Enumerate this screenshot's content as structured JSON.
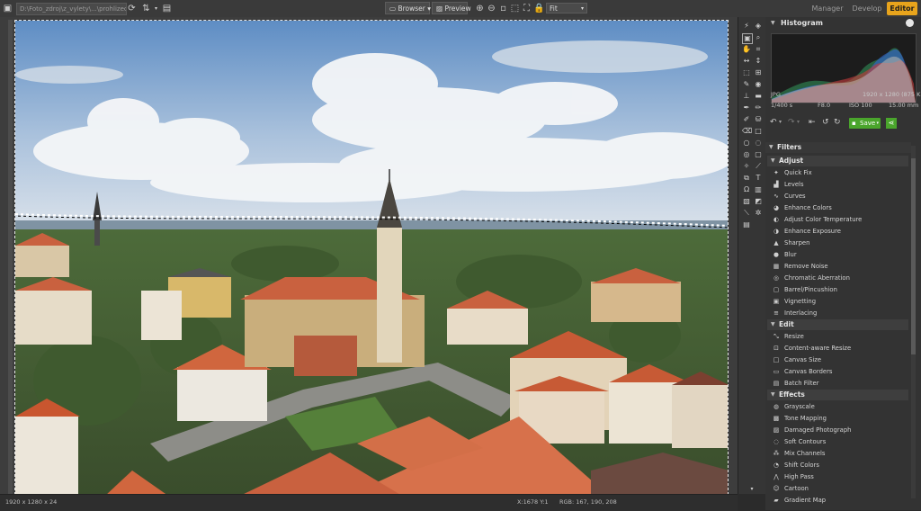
{
  "toolbar": {
    "path": "D:\\Foto_zdroj\\z_vylety\\...\\prohlizec",
    "browser_label": "Browser",
    "preview_label": "Preview",
    "zoom_value": "Fit",
    "modes": [
      "Manager",
      "Develop",
      "Editor"
    ],
    "active_mode": "Editor"
  },
  "colors": {
    "accent": "#e8a41c",
    "save_green": "#4aa52c"
  },
  "histogram": {
    "title": "Histogram",
    "format": "JPG",
    "dimensions": "1920 x 1280 (875 KB)",
    "shutter": "1/400 s",
    "aperture": "F8.0",
    "iso": "ISO 100",
    "focal": "15.00 mm"
  },
  "actions": {
    "save_label": "Save"
  },
  "filters": {
    "title": "Filters",
    "sections": [
      {
        "name": "Adjust",
        "items": [
          {
            "label": "Quick Fix",
            "icon": "wand-icon"
          },
          {
            "label": "Levels",
            "icon": "levels-icon"
          },
          {
            "label": "Curves",
            "icon": "curves-icon"
          },
          {
            "label": "Enhance Colors",
            "icon": "palette-icon"
          },
          {
            "label": "Adjust Color Temperature",
            "icon": "thermometer-icon"
          },
          {
            "label": "Enhance Exposure",
            "icon": "exposure-icon"
          },
          {
            "label": "Sharpen",
            "icon": "triangle-icon"
          },
          {
            "label": "Blur",
            "icon": "drop-icon"
          },
          {
            "label": "Remove Noise",
            "icon": "noise-icon"
          },
          {
            "label": "Chromatic Aberration",
            "icon": "aberration-icon"
          },
          {
            "label": "Barrel/Pincushion",
            "icon": "barrel-icon"
          },
          {
            "label": "Vignetting",
            "icon": "vignette-icon"
          },
          {
            "label": "Interlacing",
            "icon": "interlace-icon"
          }
        ]
      },
      {
        "name": "Edit",
        "items": [
          {
            "label": "Resize",
            "icon": "resize-icon"
          },
          {
            "label": "Content-aware Resize",
            "icon": "smart-resize-icon"
          },
          {
            "label": "Canvas Size",
            "icon": "canvas-icon"
          },
          {
            "label": "Canvas Borders",
            "icon": "border-icon"
          },
          {
            "label": "Batch Filter",
            "icon": "batch-icon"
          }
        ]
      },
      {
        "name": "Effects",
        "items": [
          {
            "label": "Grayscale",
            "icon": "grayscale-icon"
          },
          {
            "label": "Tone Mapping",
            "icon": "tone-icon"
          },
          {
            "label": "Damaged Photograph",
            "icon": "damaged-icon"
          },
          {
            "label": "Soft Contours",
            "icon": "soft-icon"
          },
          {
            "label": "Mix Channels",
            "icon": "channels-icon"
          },
          {
            "label": "Shift Colors",
            "icon": "shift-icon"
          },
          {
            "label": "High Pass",
            "icon": "highpass-icon"
          },
          {
            "label": "Cartoon",
            "icon": "cartoon-icon"
          },
          {
            "label": "Gradient Map",
            "icon": "gradient-icon"
          }
        ]
      }
    ]
  },
  "status": {
    "image_info": "1920 x 1280 x 24",
    "cursor_info": "X:1678 Y:1",
    "rgb_info": "RGB: 167, 190, 208"
  }
}
